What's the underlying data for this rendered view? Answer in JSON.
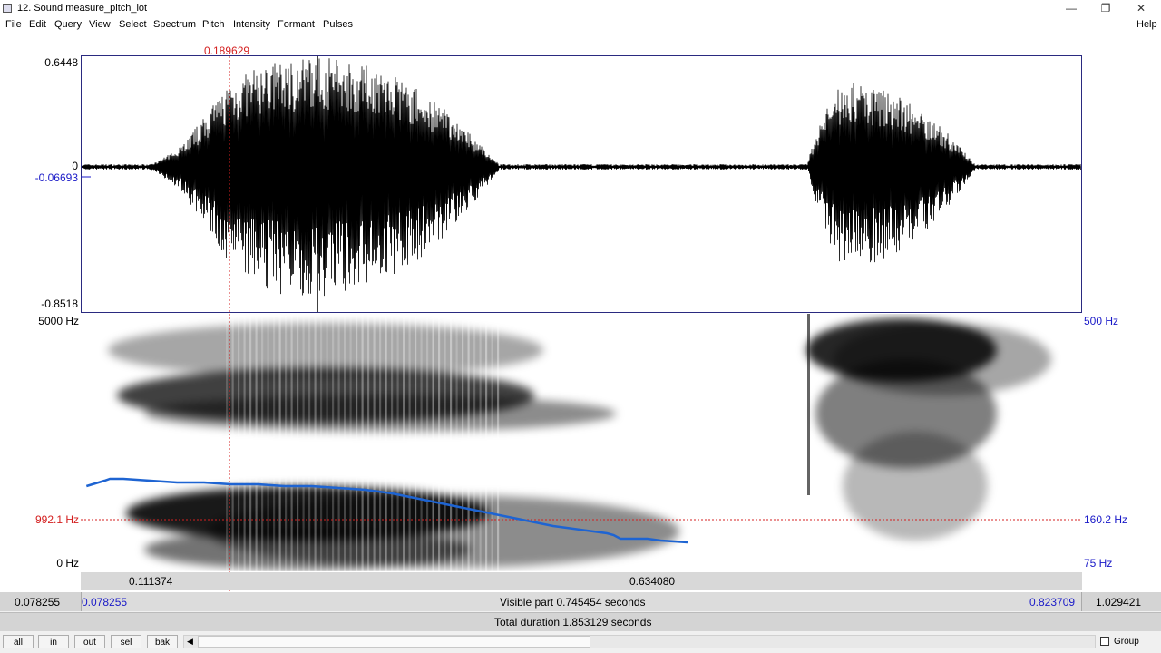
{
  "window": {
    "title": "12. Sound measure_pitch_lot",
    "minimize_icon": "minimize-icon",
    "maximize_icon": "maximize-icon",
    "close_icon": "close-icon",
    "help": "Help"
  },
  "menu": [
    "File",
    "Edit",
    "Query",
    "View",
    "Select",
    "Spectrum",
    "Pitch",
    "Intensity",
    "Formant",
    "Pulses"
  ],
  "cursor": {
    "time": "0.189629"
  },
  "waveform": {
    "max": "0.6448",
    "zero": "0",
    "cursor_value": "-0.06693",
    "min": "-0.8518"
  },
  "spectrogram": {
    "max_freq": "5000 Hz",
    "cursor_freq": "992.1 Hz",
    "min_freq": "0 Hz"
  },
  "pitch_axis": {
    "max": "500 Hz",
    "cursor": "160.2 Hz",
    "min": "75 Hz"
  },
  "pitch_track": [
    [
      0.0825,
      0.35
    ],
    [
      0.096,
      0.38
    ],
    [
      0.1,
      0.39
    ],
    [
      0.11,
      0.39
    ],
    [
      0.13,
      0.38
    ],
    [
      0.15,
      0.37
    ],
    [
      0.17,
      0.37
    ],
    [
      0.19,
      0.36
    ],
    [
      0.21,
      0.36
    ],
    [
      0.23,
      0.35
    ],
    [
      0.25,
      0.35
    ],
    [
      0.27,
      0.34
    ],
    [
      0.29,
      0.33
    ],
    [
      0.31,
      0.31
    ],
    [
      0.33,
      0.28
    ],
    [
      0.35,
      0.25
    ],
    [
      0.37,
      0.22
    ],
    [
      0.39,
      0.19
    ],
    [
      0.41,
      0.16
    ],
    [
      0.43,
      0.13
    ],
    [
      0.45,
      0.11
    ],
    [
      0.47,
      0.09
    ],
    [
      0.475,
      0.08
    ],
    [
      0.48,
      0.06
    ],
    [
      0.49,
      0.06
    ],
    [
      0.5,
      0.06
    ],
    [
      0.51,
      0.05
    ],
    [
      0.53,
      0.04
    ]
  ],
  "selection_bar": {
    "left_segment": "0.111374",
    "right_segment": "0.634080"
  },
  "visible_bar": {
    "window_start": "0.078255",
    "visible_start": "0.078255",
    "visible_text": "Visible part 0.745454 seconds",
    "visible_end": "0.823709",
    "window_end": "1.029421"
  },
  "total_bar": {
    "text": "Total duration 1.853129 seconds"
  },
  "toolbar": {
    "all": "all",
    "in": "in",
    "out": "out",
    "sel": "sel",
    "bak": "bak",
    "scroll_left_icon": "scroll-left-icon",
    "group": "Group"
  },
  "colors": {
    "cursor_red": "#d42020",
    "axis_blue": "#1a1ac8",
    "pitch_blue": "#1e64d2"
  }
}
